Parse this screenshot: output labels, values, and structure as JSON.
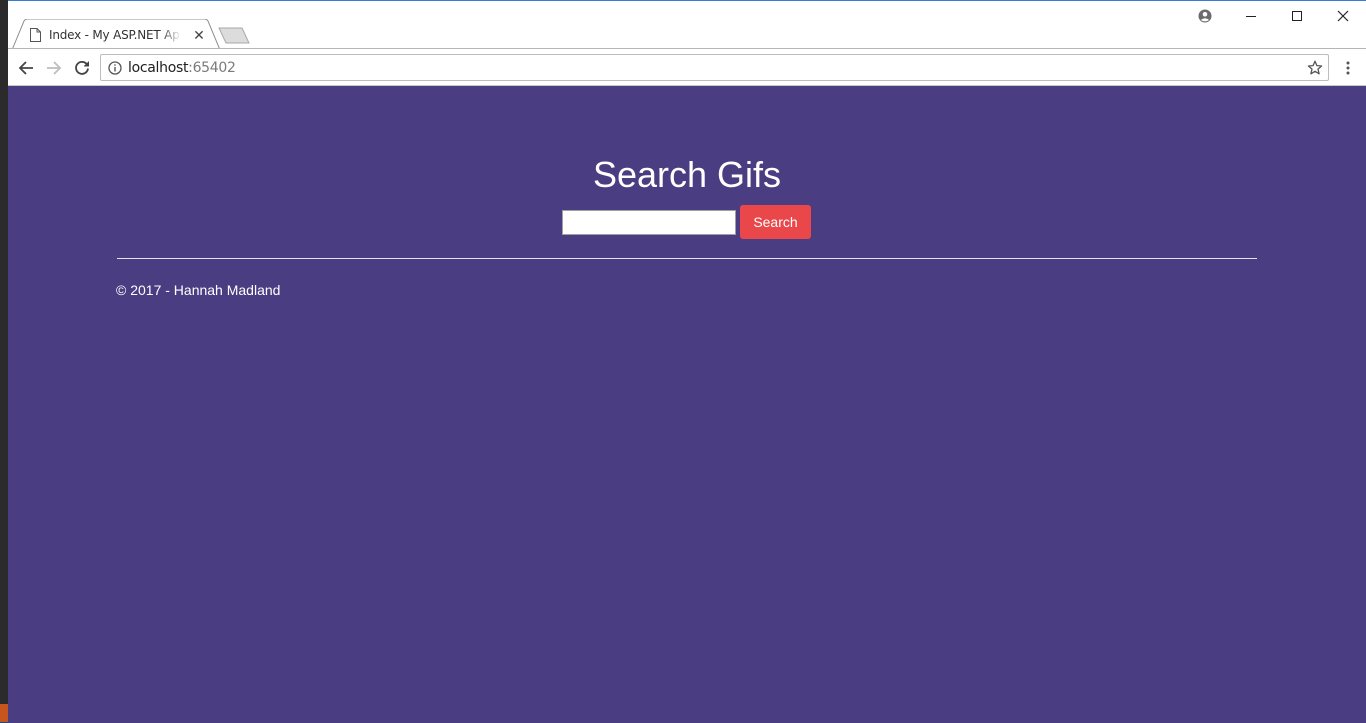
{
  "browser": {
    "tab": {
      "title": "Index - My ASP.NET App"
    },
    "address": {
      "host": "localhost",
      "port": ":65402"
    }
  },
  "page": {
    "heading": "Search Gifs",
    "search": {
      "value": "",
      "button_label": "Search"
    },
    "footer": "© 2017 - Hannah Madland"
  },
  "colors": {
    "page_background": "#4a3d82",
    "search_button": "#e9474a"
  }
}
